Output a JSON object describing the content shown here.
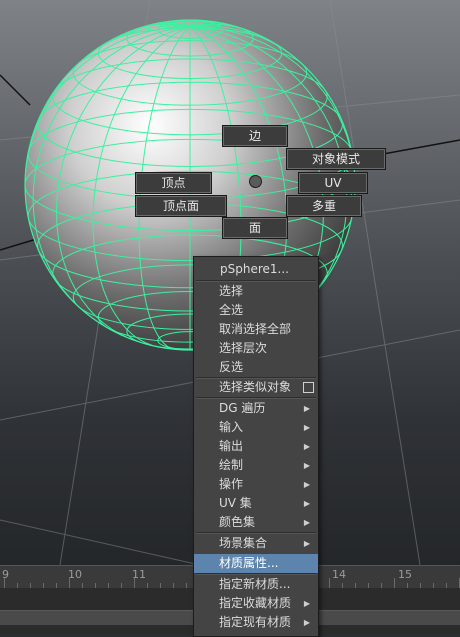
{
  "viewport": {
    "object_name": "pSphere1",
    "marking_menu": {
      "north": "边",
      "northeast": "对象模式",
      "east": "UV",
      "southeast": "多重",
      "west": "顶点",
      "southwest": "顶点面",
      "south": "面"
    }
  },
  "context_menu": {
    "title": "pSphere1...",
    "items": [
      {
        "label": "选择"
      },
      {
        "label": "全选"
      },
      {
        "label": "取消选择全部"
      },
      {
        "label": "选择层次"
      },
      {
        "label": "反选"
      },
      {
        "label": "选择类似对象"
      },
      {
        "label": "DG 遍历"
      },
      {
        "label": "输入"
      },
      {
        "label": "输出"
      },
      {
        "label": "绘制"
      },
      {
        "label": "操作"
      },
      {
        "label": "UV 集"
      },
      {
        "label": "颜色集"
      },
      {
        "label": "场景集合"
      },
      {
        "label": "材质属性..."
      },
      {
        "label": "指定新材质..."
      },
      {
        "label": "指定收藏材质"
      },
      {
        "label": "指定现有材质"
      }
    ],
    "highlighted": "材质属性..."
  },
  "timeline": {
    "ticks": [
      "9",
      "10",
      "11",
      "14",
      "15"
    ]
  },
  "colors": {
    "wireframe": "#3cf0a0",
    "highlight": "#5d84ad"
  }
}
